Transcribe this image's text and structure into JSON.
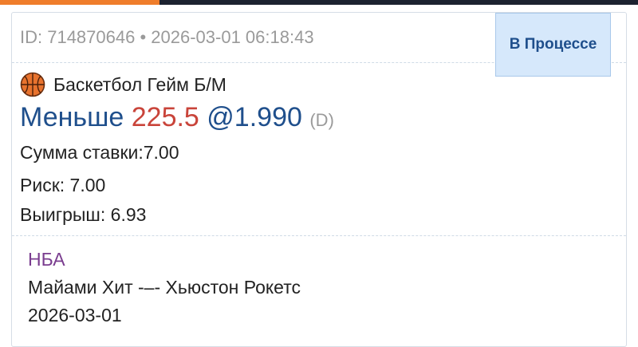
{
  "colors": {
    "accent_orange": "#ef7d2b",
    "topbar_dark": "#1c2230",
    "selection_blue": "#1f4f8c",
    "line_red": "#c9443a",
    "league_purple": "#7a3d8f",
    "status_bg": "#d6e8fb",
    "muted_gray": "#9a9a9a"
  },
  "bet": {
    "meta": "ID: 714870646 • 2026-03-01 06:18:43",
    "status": "В Процессе",
    "sport_icon": "basketball-icon",
    "market": "Баскетбол Гейм Б/М",
    "selection": "Меньше",
    "line": "225.5",
    "odds": "@1.990",
    "odds_format": "(D)",
    "stake": "Сумма ставки:7.00",
    "risk": "Риск: 7.00",
    "payout": "Выигрыш: 6.93"
  },
  "event": {
    "league": "НБА",
    "matchup": "Майами Хит -–- Хьюстон Рокетс",
    "date": "2026-03-01"
  }
}
